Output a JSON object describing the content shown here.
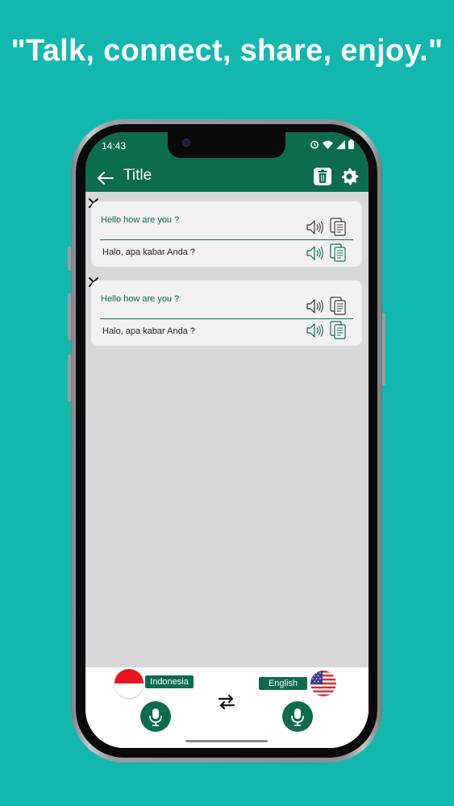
{
  "tagline": "\"Talk, connect, share, enjoy.\"",
  "status_bar": {
    "time": "14:43"
  },
  "app_bar": {
    "title": "Title"
  },
  "conversations": [
    {
      "source_text": "Hello how are you ?",
      "translated_text": "Halo, apa kabar Anda ?"
    },
    {
      "source_text": "Hello how are you ?",
      "translated_text": "Halo, apa kabar Anda ?"
    }
  ],
  "bottom_panel": {
    "left_language": "Indonesia",
    "right_language": "English"
  },
  "colors": {
    "background": "#12b8ad",
    "brand_green": "#0d6b4e",
    "screen_bg": "#d8d7d9"
  },
  "icons": [
    "back-arrow-icon",
    "trash-icon",
    "gear-icon",
    "close-icon",
    "speaker-icon",
    "copy-icon",
    "swap-icon",
    "microphone-icon",
    "indonesia-flag-icon",
    "usa-flag-icon"
  ]
}
